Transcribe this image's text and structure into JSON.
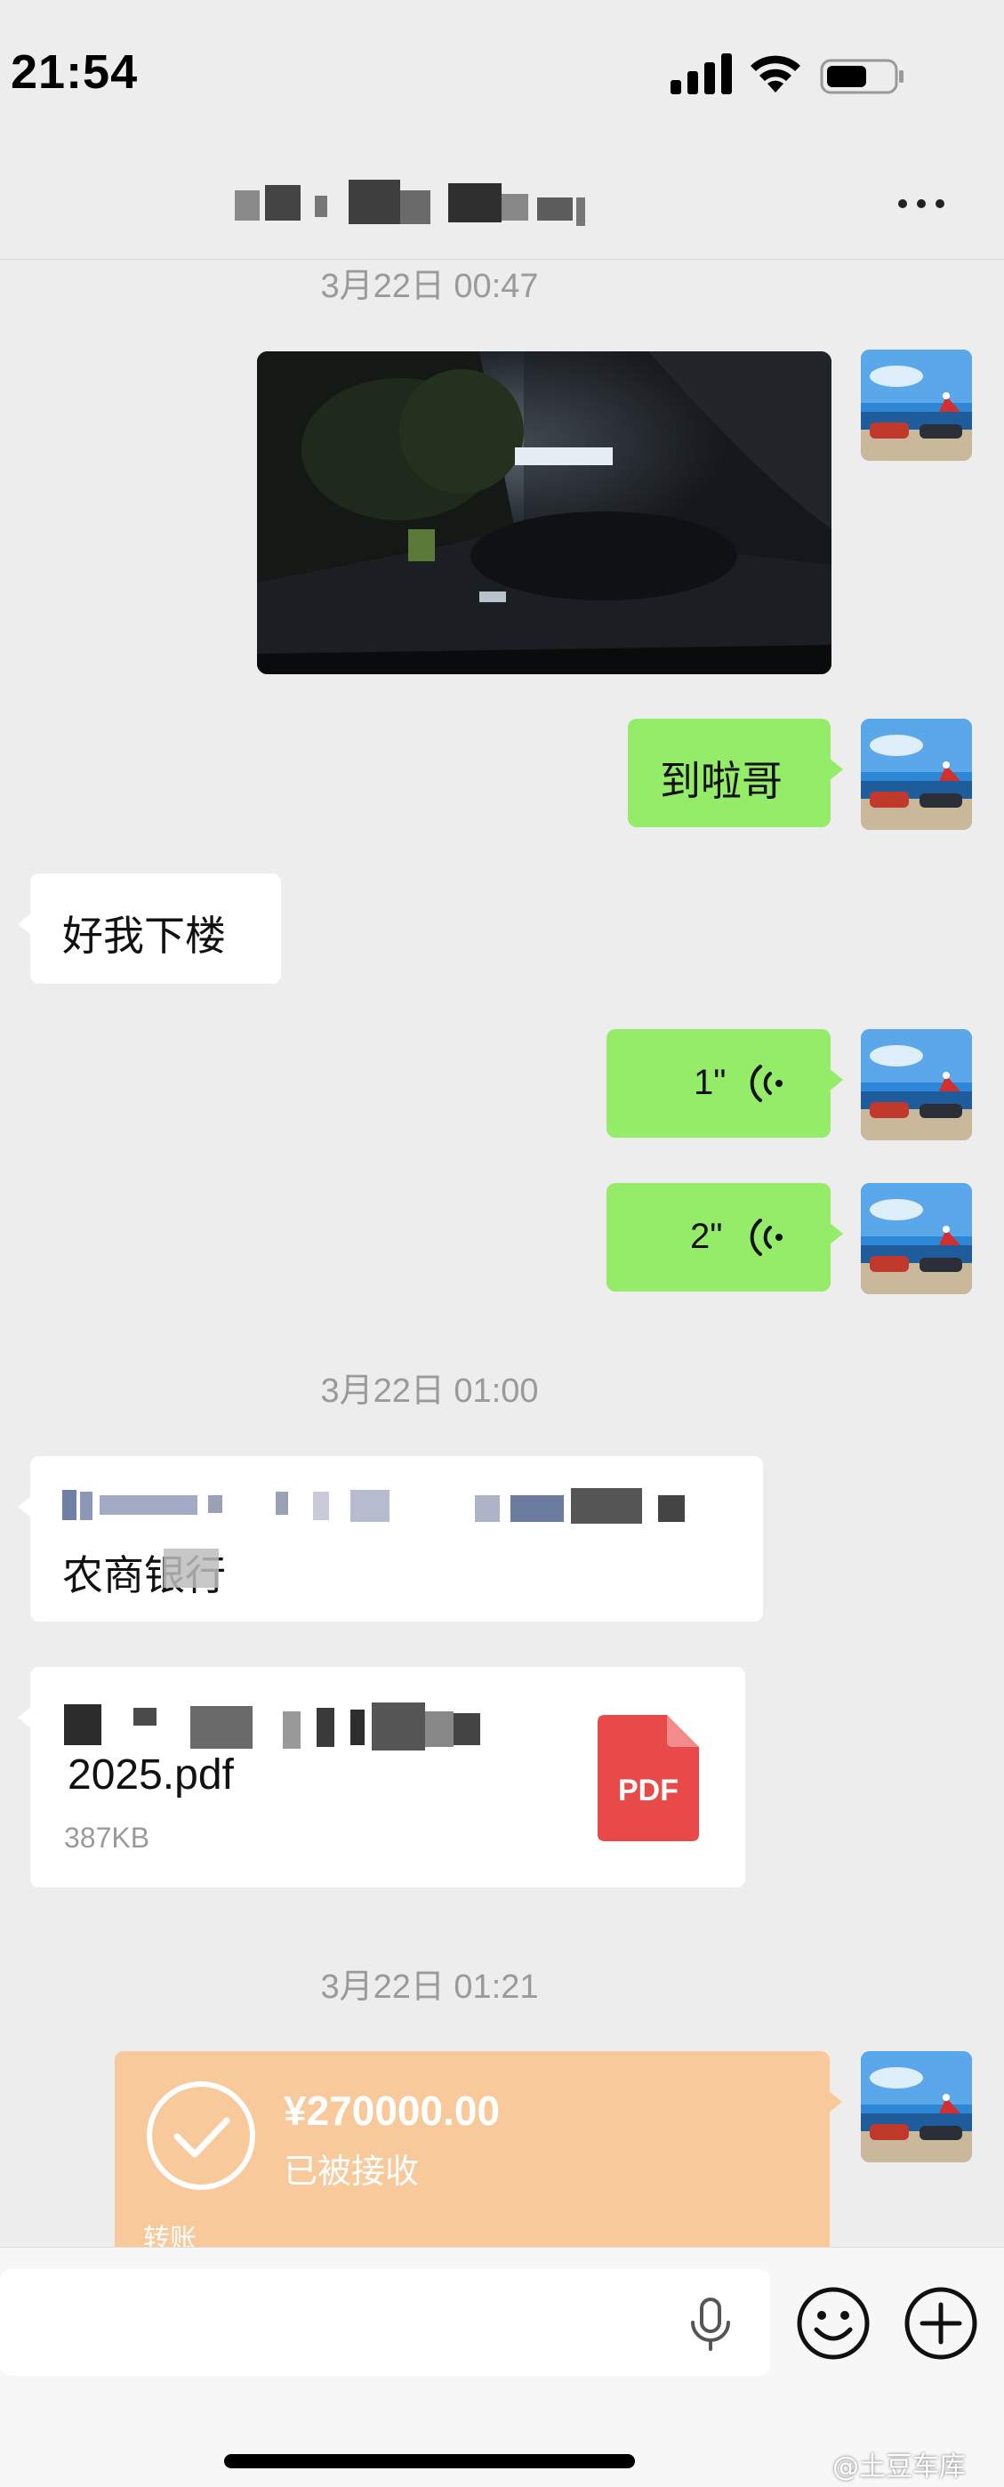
{
  "status_bar": {
    "time": "21:54"
  },
  "chat": {
    "title": ""
  },
  "messages": {
    "timestamp_1": "3月22日 00:47",
    "text_out_1": "到啦哥",
    "text_in_1": "好我下楼",
    "voice_1_duration": "1\"",
    "voice_2_duration": "2\"",
    "timestamp_2": "3月22日 01:00",
    "bank_line_2": "农商银行",
    "file_name_line2": "2025.pdf",
    "file_size": "387KB",
    "file_type_label": "PDF",
    "timestamp_3": "3月22日 01:21",
    "transfer_amount": "¥270000.00",
    "transfer_status": "已被接收",
    "transfer_label": "转账"
  },
  "watermark": "@土豆车库",
  "colors": {
    "background": "#ededed",
    "outgoing_bubble": "#95ec69",
    "incoming_bubble": "#ffffff",
    "transfer_card": "#f8c99a",
    "pdf_red": "#e84a4a"
  },
  "icons": [
    "signal-icon",
    "wifi-icon",
    "battery-icon",
    "more-icon",
    "voice-wave-icon",
    "pdf-file-icon",
    "check-icon",
    "microphone-icon",
    "emoji-icon",
    "plus-icon"
  ]
}
